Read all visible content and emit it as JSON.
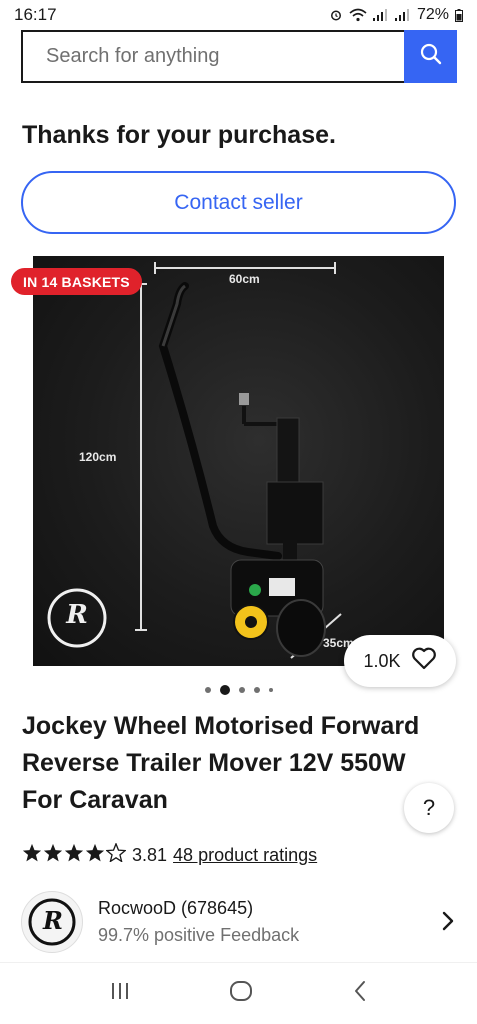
{
  "status_bar": {
    "time": "16:17",
    "battery": "72%"
  },
  "search": {
    "placeholder": "Search for anything"
  },
  "thanks_message": "Thanks for your purchase.",
  "contact_button": "Contact seller",
  "product_image": {
    "badge": "IN 14 BASKETS",
    "dim_width": "60cm",
    "dim_height": "120cm",
    "dim_depth": "35cm",
    "brand_mark": "R"
  },
  "watch": {
    "count": "1.0K"
  },
  "carousel": {
    "total": 5,
    "active_index": 1
  },
  "product_title": "Jockey Wheel Motorised Forward Reverse Trailer Mover 12V 550W For Caravan",
  "help_label": "?",
  "rating": {
    "stars": 3.81,
    "value": "3.81",
    "count_label": "48 product ratings"
  },
  "seller": {
    "name": "RocwooD (678645)",
    "feedback": "99.7% positive Feedback",
    "avatar_mark": "R"
  },
  "colors": {
    "accent": "#3665f3",
    "badge": "#e0222b",
    "text": "#191919",
    "muted": "#707070"
  }
}
